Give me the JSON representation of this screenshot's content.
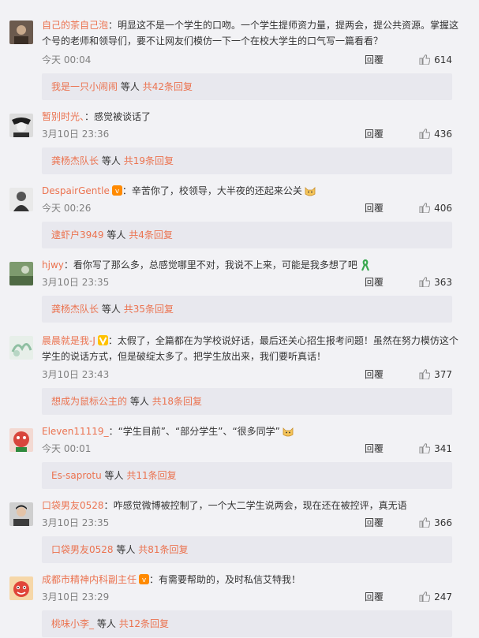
{
  "comments": [
    {
      "username": "自己的茶自己泡",
      "text": "明显这不是一个学生的口吻。一个学生提师资力量，提两会，提公共资源。掌握这个号的老师和领导们，要不让网友们模仿一下一个在校大学生的口气写一篇看看？",
      "time": "今天 00:04",
      "reply": "回覆",
      "likes": "614",
      "sub_user": "我是一只小闹闹",
      "sub_mid": "等人",
      "sub_count": "共42条回复",
      "avatar_color": "#6b5a4e"
    },
    {
      "username": "暂别时光、",
      "text": "感觉被谈话了",
      "time": "3月10日 23:36",
      "reply": "回覆",
      "likes": "436",
      "sub_user": "龚杨杰队长",
      "sub_mid": "等人",
      "sub_count": "共19条回复",
      "avatar_color": "#2e2e2e"
    },
    {
      "username": "DespairGentle",
      "text": "辛苦你了，校领导，大半夜的还起来公关",
      "time": "今天 00:26",
      "reply": "回覆",
      "likes": "406",
      "sub_user": "逮虾户3949",
      "sub_mid": "等人",
      "sub_count": "共4条回复",
      "avatar_color": "#7a7a7a"
    },
    {
      "username": "hjwy",
      "text": "看你写了那么多，总感觉哪里不对，我说不上来，可能是我多想了吧",
      "time": "3月10日 23:35",
      "reply": "回覆",
      "likes": "363",
      "sub_user": "龚杨杰队长",
      "sub_mid": "等人",
      "sub_count": "共35条回复",
      "avatar_color": "#5f7a55"
    },
    {
      "username": "晨晨就是我-J",
      "text": "太假了，全篇都在为学校说好话，最后还关心招生报考问题！虽然在努力模仿这个学生的说话方式，但是破绽太多了。把学生放出来，我们要听真话！",
      "time": "3月10日 23:43",
      "reply": "回覆",
      "likes": "377",
      "sub_user": "想成为鼠标公主的",
      "sub_mid": "等人",
      "sub_count": "共18条回复",
      "avatar_color": "#b7d6c4"
    },
    {
      "username": "Eleven11119_",
      "text": "“学生目前”、“部分学生”、“很多同学”",
      "time": "今天 00:01",
      "reply": "回覆",
      "likes": "341",
      "sub_user": "Es-saprotu",
      "sub_mid": "等人",
      "sub_count": "共11条回复",
      "avatar_color": "#d8453c"
    },
    {
      "username": "口袋男友0528",
      "text": "咋感觉微博被控制了，一个大二学生说两会，现在还在被控评，真无语",
      "time": "3月10日 23:35",
      "reply": "回覆",
      "likes": "366",
      "sub_user": "口袋男友0528",
      "sub_mid": "等人",
      "sub_count": "共81条回复",
      "avatar_color": "#3d3d3d"
    },
    {
      "username": "成都市精神内科副主任",
      "text": "有需要帮助的，及时私信艾特我！",
      "time": "3月10日 23:29",
      "reply": "回覆",
      "likes": "247",
      "sub_user": "桃味小李_",
      "sub_mid": "等人",
      "sub_count": "共12条回复",
      "avatar_color": "#e0453a"
    }
  ]
}
